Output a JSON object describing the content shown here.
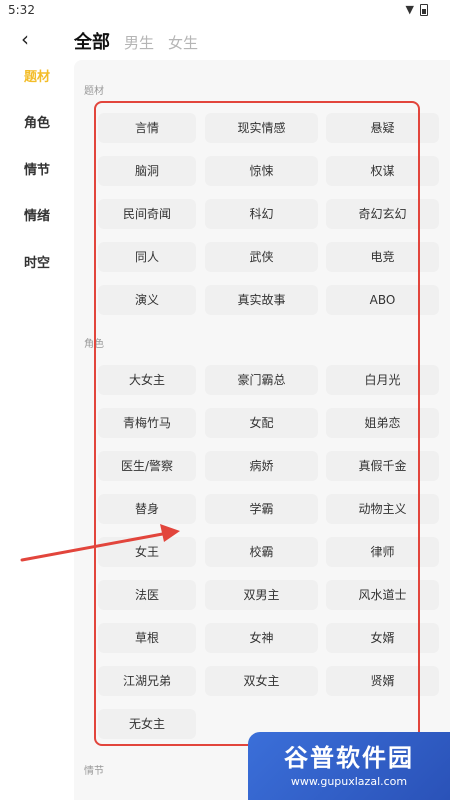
{
  "status_bar": {
    "time": "5:32"
  },
  "header": {
    "tabs": [
      {
        "label": "全部",
        "active": true
      },
      {
        "label": "男生",
        "active": false
      },
      {
        "label": "女生",
        "active": false
      }
    ]
  },
  "sidebar": {
    "items": [
      {
        "label": "题材",
        "active": true
      },
      {
        "label": "角色",
        "active": false
      },
      {
        "label": "情节",
        "active": false
      },
      {
        "label": "情绪",
        "active": false
      },
      {
        "label": "时空",
        "active": false
      }
    ]
  },
  "sections": [
    {
      "title": "题材",
      "tags": [
        "言情",
        "现实情感",
        "悬疑",
        "脑洞",
        "惊悚",
        "权谋",
        "民间奇闻",
        "科幻",
        "奇幻玄幻",
        "同人",
        "武侠",
        "电竞",
        "演义",
        "真实故事",
        "ABO"
      ]
    },
    {
      "title": "角色",
      "tags": [
        "大女主",
        "豪门霸总",
        "白月光",
        "青梅竹马",
        "女配",
        "姐弟恋",
        "医生/警察",
        "病娇",
        "真假千金",
        "替身",
        "学霸",
        "动物主义",
        "女王",
        "校霸",
        "律师",
        "法医",
        "双男主",
        "风水道士",
        "草根",
        "女神",
        "女婿",
        "江湖兄弟",
        "双女主",
        "贤婿",
        "无女主"
      ]
    },
    {
      "title": "情节",
      "tags": []
    }
  ],
  "colors": {
    "accent": "#f3bd2a",
    "annotation": "#e2453c",
    "chip_bg": "#f0f0f0",
    "content_bg": "#f7f7f7"
  },
  "watermark": {
    "title": "谷普软件园",
    "url": "www.gupuxlazal.com"
  }
}
